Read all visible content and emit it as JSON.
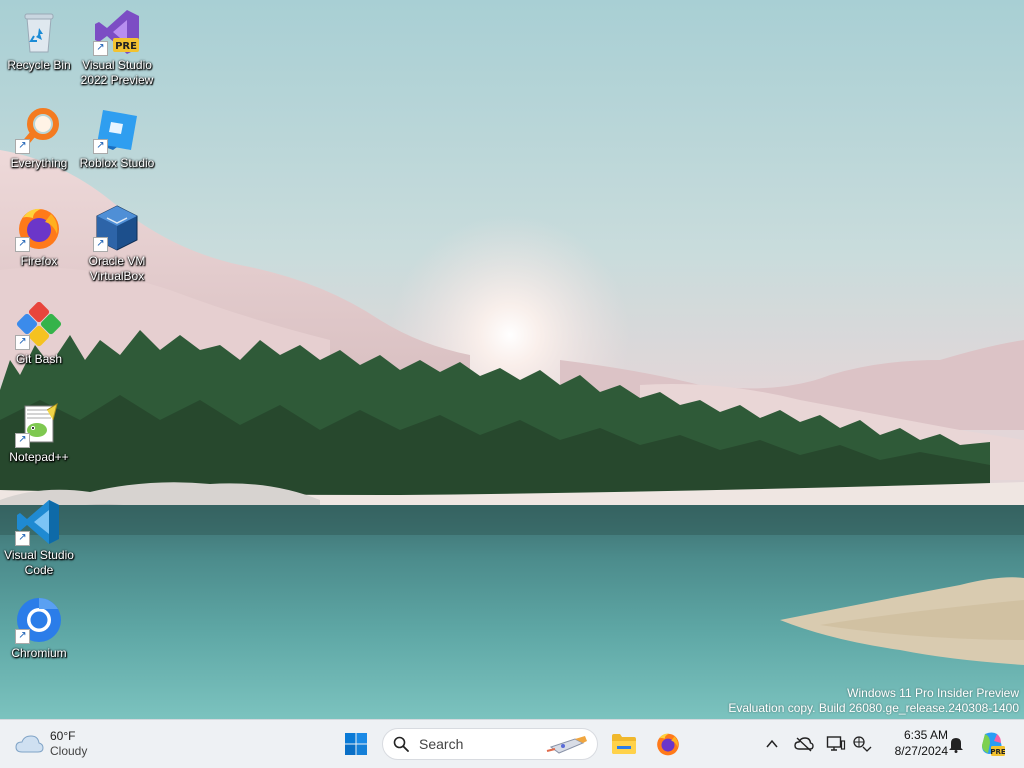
{
  "desktop": {
    "icons": [
      {
        "label": "Recycle Bin"
      },
      {
        "label": "Visual Studio 2022 Preview"
      },
      {
        "label": "Everything"
      },
      {
        "label": "Roblox Studio"
      },
      {
        "label": "Firefox"
      },
      {
        "label": "Oracle VM VirtualBox"
      },
      {
        "label": "Git Bash"
      },
      {
        "label": "Notepad++"
      },
      {
        "label": "Visual Studio Code"
      },
      {
        "label": "Chromium"
      }
    ],
    "pre_badge": "PRE",
    "watermark": {
      "line1": "Windows 11 Pro Insider Preview",
      "line2": "Evaluation copy. Build 26080.ge_release.240308-1400"
    }
  },
  "taskbar": {
    "weather": {
      "temp": "60°F",
      "condition": "Cloudy",
      "icon": "cloud-icon"
    },
    "start_icon": "windows-logo-icon",
    "search": {
      "placeholder": "Search"
    },
    "pinned": [
      {
        "name": "File Explorer",
        "icon": "folder-icon"
      },
      {
        "name": "Firefox",
        "icon": "firefox-icon"
      }
    ],
    "tray": {
      "icons": [
        "chevron-up-icon",
        "cloud-off-icon",
        "display-icon",
        "language-icon"
      ],
      "time": "6:35 AM",
      "date": "8/27/2024",
      "copilot_badge": "PRE"
    }
  },
  "colors": {
    "accent": "#0067c0",
    "taskbar_bg": "#eef1f4"
  }
}
